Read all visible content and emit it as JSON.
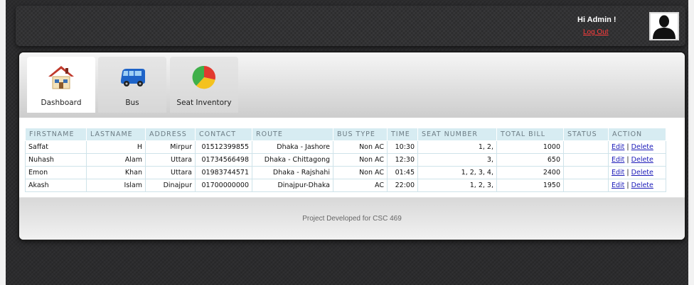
{
  "header": {
    "greeting": "Hi Admin !",
    "logout_label": "Log Out"
  },
  "nav": {
    "tabs": [
      {
        "label": "Dashboard",
        "icon": "house-icon",
        "active": true
      },
      {
        "label": "Bus",
        "icon": "bus-icon",
        "active": false
      },
      {
        "label": "Seat Inventory",
        "icon": "pie-chart-icon",
        "active": false
      }
    ]
  },
  "table": {
    "columns": [
      "FIRSTNAME",
      "LASTNAME",
      "ADDRESS",
      "CONTACT",
      "ROUTE",
      "BUS TYPE",
      "TIME",
      "SEAT NUMBER",
      "TOTAL BILL",
      "STATUS",
      "ACTION"
    ],
    "rows": [
      {
        "firstname": "Saffat",
        "lastname": "H",
        "address": "Mirpur",
        "contact": "01512399855",
        "route": "Dhaka - Jashore",
        "bus_type": "Non AC",
        "time": "10:30",
        "seat_number": "1, 2,",
        "total_bill": "1000",
        "status": "",
        "edit": "Edit",
        "delete": "Delete"
      },
      {
        "firstname": "Nuhash",
        "lastname": "Alam",
        "address": "Uttara",
        "contact": "01734566498",
        "route": "Dhaka - Chittagong",
        "bus_type": "Non AC",
        "time": "12:30",
        "seat_number": "3,",
        "total_bill": "650",
        "status": "",
        "edit": "Edit",
        "delete": "Delete"
      },
      {
        "firstname": "Emon",
        "lastname": "Khan",
        "address": "Uttara",
        "contact": "01983744571",
        "route": "Dhaka - Rajshahi",
        "bus_type": "Non AC",
        "time": "01:45",
        "seat_number": "1, 2, 3, 4,",
        "total_bill": "2400",
        "status": "",
        "edit": "Edit",
        "delete": "Delete"
      },
      {
        "firstname": "Akash",
        "lastname": "Islam",
        "address": "Dinajpur",
        "contact": "01700000000",
        "route": "Dinajpur-Dhaka",
        "bus_type": "AC",
        "time": "22:00",
        "seat_number": "1, 2, 3,",
        "total_bill": "1950",
        "status": "",
        "edit": "Edit",
        "delete": "Delete"
      }
    ]
  },
  "footer": {
    "text": "Project Developed for CSC 469"
  },
  "colors": {
    "background": "#2c2c2e",
    "logout_link": "#ff3c3c",
    "table_header": "#d7ecf2",
    "action_link": "#1a1ab8"
  }
}
